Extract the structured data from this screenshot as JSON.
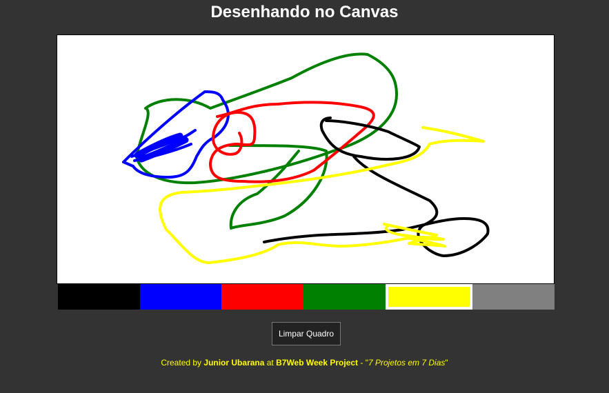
{
  "header": {
    "title": "Desenhando no Canvas"
  },
  "palette": {
    "colors": [
      {
        "name": "black",
        "hex": "#000000",
        "active": false
      },
      {
        "name": "blue",
        "hex": "#0000ff",
        "active": false
      },
      {
        "name": "red",
        "hex": "#ff0000",
        "active": false
      },
      {
        "name": "green",
        "hex": "#008000",
        "active": false
      },
      {
        "name": "yellow",
        "hex": "#ffff00",
        "active": true
      },
      {
        "name": "gray",
        "hex": "#808080",
        "active": false
      }
    ]
  },
  "actions": {
    "clear_label": "Limpar Quadro"
  },
  "footer": {
    "created_by": "Created by ",
    "author": "Junior Ubarana",
    "at": " at ",
    "project": "B7Web Week Project",
    "dash": " - \"",
    "tagline": "7 Projetos em 7 Dias",
    "close_quote": "\""
  },
  "colors": {
    "background": "#333333",
    "canvas": "#ffffff",
    "footer_text": "#ffff00",
    "title_text": "#ffffff"
  }
}
